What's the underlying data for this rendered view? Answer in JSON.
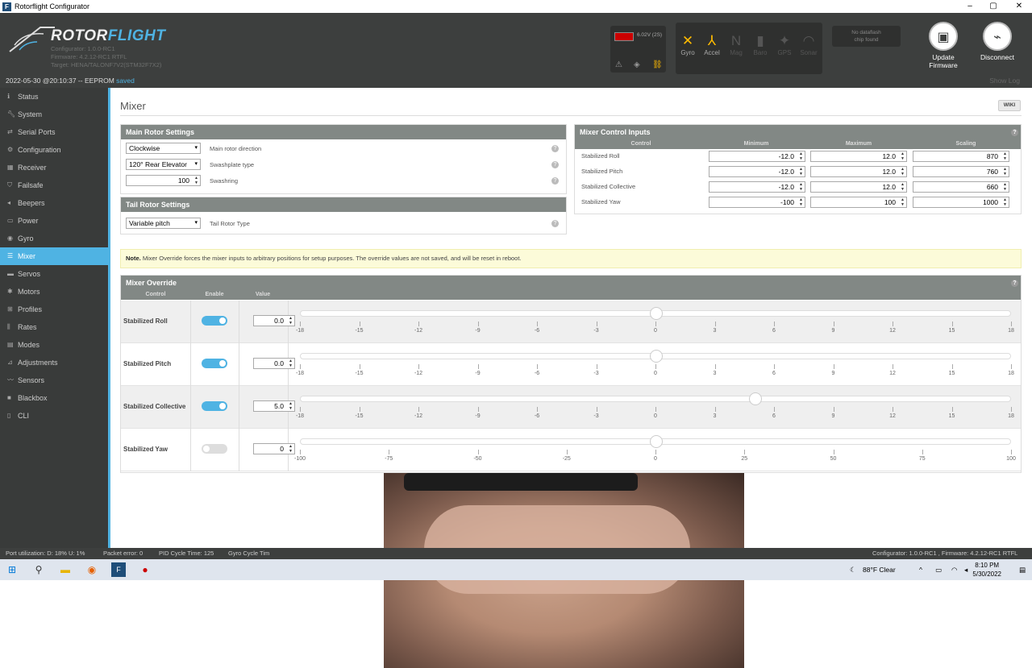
{
  "window": {
    "title": "Rotorflight Configurator",
    "minimize": "–",
    "maximize": "▢",
    "close": "✕"
  },
  "header": {
    "logo_part1": "ROTOR",
    "logo_part2": "FLIGHT",
    "configurator_version": "Configurator: 1.0.0-RC1",
    "firmware_version": "Firmware: 4.2.12-RC1 RTFL",
    "target": "Target: HENA/TALONF7V2(STM32F7X2)",
    "battery_voltage": "6.02V (2S)",
    "sensors": [
      {
        "label": "Gyro",
        "active": true
      },
      {
        "label": "Accel",
        "active": true
      },
      {
        "label": "Mag",
        "active": false
      },
      {
        "label": "Baro",
        "active": false
      },
      {
        "label": "GPS",
        "active": false
      },
      {
        "label": "Sonar",
        "active": false
      }
    ],
    "dataflash_line1": "No dataflash",
    "dataflash_line2": "chip found",
    "update_firmware": "Update Firmware",
    "disconnect": "Disconnect"
  },
  "status_strip": {
    "timestamp": "2022-05-30 @20:10:37 -- EEPROM",
    "saved": "saved",
    "show_log": "Show Log"
  },
  "sidebar": {
    "items": [
      {
        "label": "Status",
        "icon": "info-icon"
      },
      {
        "label": "System",
        "icon": "wrench-icon"
      },
      {
        "label": "Serial Ports",
        "icon": "plug-icon"
      },
      {
        "label": "Configuration",
        "icon": "gear-icon"
      },
      {
        "label": "Receiver",
        "icon": "radio-icon"
      },
      {
        "label": "Failsafe",
        "icon": "shield-icon"
      },
      {
        "label": "Beepers",
        "icon": "speaker-icon"
      },
      {
        "label": "Power",
        "icon": "battery-icon"
      },
      {
        "label": "Gyro",
        "icon": "gyro-icon"
      },
      {
        "label": "Mixer",
        "icon": "mixer-icon",
        "active": true
      },
      {
        "label": "Servos",
        "icon": "servo-icon"
      },
      {
        "label": "Motors",
        "icon": "motor-icon"
      },
      {
        "label": "Profiles",
        "icon": "profile-icon"
      },
      {
        "label": "Rates",
        "icon": "rates-icon"
      },
      {
        "label": "Modes",
        "icon": "modes-icon"
      },
      {
        "label": "Adjustments",
        "icon": "adjust-icon"
      },
      {
        "label": "Sensors",
        "icon": "sensor-icon"
      },
      {
        "label": "Blackbox",
        "icon": "blackbox-icon"
      },
      {
        "label": "CLI",
        "icon": "terminal-icon"
      }
    ]
  },
  "page": {
    "title": "Mixer",
    "wiki": "WIKI"
  },
  "main_rotor": {
    "title": "Main Rotor Settings",
    "direction_value": "Clockwise",
    "direction_label": "Main rotor direction",
    "swashplate_value": "120° Rear Elevator",
    "swashplate_label": "Swashplate type",
    "swashring_value": "100",
    "swashring_label": "Swashring"
  },
  "tail_rotor": {
    "title": "Tail Rotor Settings",
    "type_value": "Variable pitch",
    "type_label": "Tail Rotor Type"
  },
  "control_inputs": {
    "title": "Mixer Control Inputs",
    "headers": [
      "Control",
      "Minimum",
      "Maximum",
      "Scaling"
    ],
    "rows": [
      {
        "name": "Stabilized Roll",
        "min": "-12.0",
        "max": "12.0",
        "scale": "870"
      },
      {
        "name": "Stabilized Pitch",
        "min": "-12.0",
        "max": "12.0",
        "scale": "760"
      },
      {
        "name": "Stabilized Collective",
        "min": "-12.0",
        "max": "12.0",
        "scale": "660"
      },
      {
        "name": "Stabilized Yaw",
        "min": "-100",
        "max": "100",
        "scale": "1000"
      }
    ]
  },
  "note": {
    "bold": "Note.",
    "text": "Mixer Override forces the mixer inputs to arbitrary positions for setup purposes. The override values are not saved, and will be reset in reboot."
  },
  "override": {
    "title": "Mixer Override",
    "headers": [
      "Control",
      "Enable",
      "Value"
    ],
    "rows": [
      {
        "name": "Stabilized Roll",
        "enabled": true,
        "value": "0.0",
        "ticks": [
          "-18",
          "-15",
          "-12",
          "-9",
          "-6",
          "-3",
          "0",
          "3",
          "6",
          "9",
          "12",
          "15",
          "18"
        ],
        "min": -18,
        "max": 18,
        "level": 0
      },
      {
        "name": "Stabilized Pitch",
        "enabled": true,
        "value": "0.0",
        "ticks": [
          "-18",
          "-15",
          "-12",
          "-9",
          "-6",
          "-3",
          "0",
          "3",
          "6",
          "9",
          "12",
          "15",
          "18"
        ],
        "min": -18,
        "max": 18,
        "level": 0
      },
      {
        "name": "Stabilized Collective",
        "enabled": true,
        "value": "5.0",
        "ticks": [
          "-18",
          "-15",
          "-12",
          "-9",
          "-6",
          "-3",
          "0",
          "3",
          "6",
          "9",
          "12",
          "15",
          "18"
        ],
        "min": -18,
        "max": 18,
        "level": 5
      },
      {
        "name": "Stabilized Yaw",
        "enabled": false,
        "value": "0",
        "ticks": [
          "-100",
          "-75",
          "-50",
          "-25",
          "0",
          "25",
          "50",
          "75",
          "100"
        ],
        "min": -100,
        "max": 100,
        "level": 0
      }
    ]
  },
  "bottom_bar": {
    "port_util": "Port utilization: D: 18% U: 1%",
    "packet_error": "Packet error: 0",
    "pid_cycle": "PID Cycle Time: 125",
    "gyro_cycle": "Gyro Cycle Tim",
    "version_info": "Configurator: 1.0.0-RC1 , Firmware: 4.2.12-RC1 RTFL"
  },
  "taskbar": {
    "weather": "88°F  Clear",
    "time": "8:10 PM",
    "date": "5/30/2022"
  }
}
